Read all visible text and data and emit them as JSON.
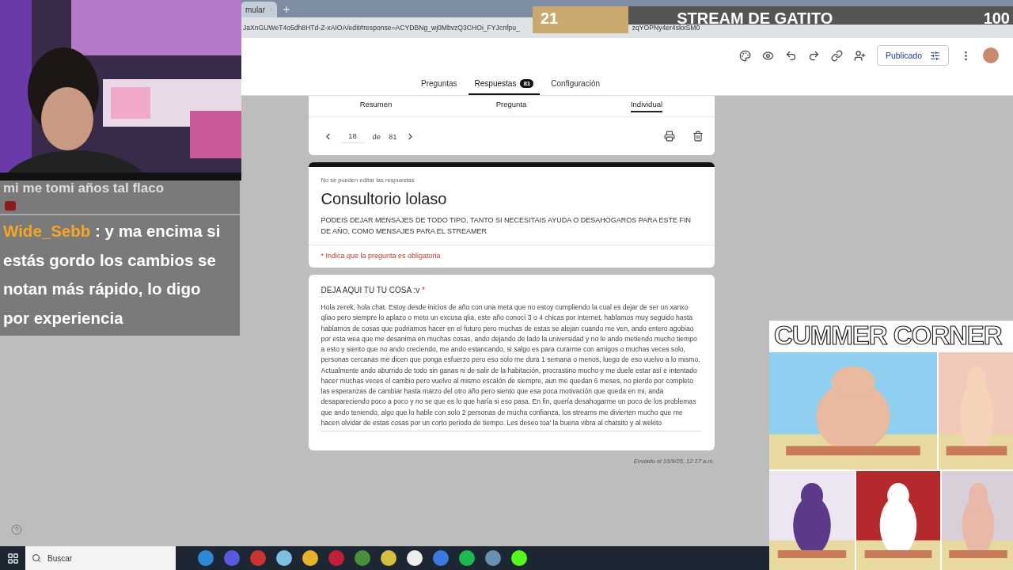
{
  "browser": {
    "tab_title": "mular",
    "url_left": "JaXnGUWeT4o5dh8HTd-Z-xAIOA/edit#response=ACYDBNg_wj0MbvzQ3CHOi_FYJcnfpu_",
    "url_right": "zqYOPNy4er4skxSM0"
  },
  "stream_goal": {
    "count": "21",
    "title": "STREAM DE GATITO",
    "target": "100",
    "level": 0.2
  },
  "form_header": {
    "publish_button": "Publicado",
    "tabs": [
      {
        "label": "Preguntas",
        "selected": false
      },
      {
        "label": "Respuestas",
        "badge": "81",
        "selected": true
      },
      {
        "label": "Configuración",
        "selected": false
      }
    ]
  },
  "response_tabs": [
    {
      "label": "Resumen",
      "selected": false
    },
    {
      "label": "Pregunta",
      "selected": false
    },
    {
      "label": "Individual",
      "selected": true
    }
  ],
  "navigator": {
    "current": "18",
    "of": "de",
    "total": "81"
  },
  "form": {
    "notice": "No se pueden editar las respuestas",
    "title": "Consultorio lolaso",
    "description": "PODEIS DEJAR MENSAJES DE TODO TIPO, TANTO SI NECESITAIS AYUDA O DESAHOGAROS PARA ESTE FIN DE AÑO, COMO MENSAJES PARA EL STREAMER",
    "required_note": "* Indica que la pregunta es obligatoria"
  },
  "question": {
    "label": "DEJA AQUI TU TU COSA :v",
    "required_mark": "*",
    "answer": "Hola zerek, hola chat. Estoy desde inicios de año con una meta que no estoy cumpliendo la cual es dejar de ser un xanxo qliao pero siempre lo aplazo o meto un excusa qlia, este año conocí 3 o 4 chicas por internet, hablamos muy seguido hasta hablamos de cosas que podriamos hacer en el futuro  pero muchas de estas se alejan cuando me ven, ando entero agobiao por esta wea que me desanima en muchas cosas, ando dejando de lado la universidad y no le ando metiendo mucho tiempo a esto y siento que no ando creciendo, me ando estancando, si salgo es para curarme con amigos o muchas veces solo, personas cercanas me dicen que ponga esfuerzo pero eso solo me dura 1 semana o menos, luego de eso vuelvo a lo mismo. Actualmente ando aburrido de todo sin ganas ni de salir de la habitación, procrastino mucho y me duele estar así e intentado hacer muchas veces el cambio pero vuelvo al mismo escalón de siempre, aun me quedan 6 meses, no pierdo por completo las esperanzas de cambiar hasta marzo del otro año pero siento que esa poca motivación que queda en mi, anda desapareciendo poco a poco y no se que es lo que haría si eso pasa. En fin, quería desahogarme un poco de los problemas que ando teniendo, algo que lo hable con solo 2 personas de mucha confianza, los streams me divierten mucho que me hacen olvidar de estas cosas por un corto periodo de tiempo. Les deseo toa' la buena vibra al chatsito y al wekito"
  },
  "sent": "Enviado el 16/9/25, 12:17 a.m.",
  "chat": {
    "cut_line": "mi me tomi años tal flaco",
    "user": "Wide_Sebb",
    "separator": ":",
    "message": "y ma encima si estás gordo los cambios se notan más rápido, lo digo por experiencia"
  },
  "corner": {
    "title": "CUMMER CORNER"
  },
  "taskbar": {
    "search_placeholder": "Buscar"
  }
}
